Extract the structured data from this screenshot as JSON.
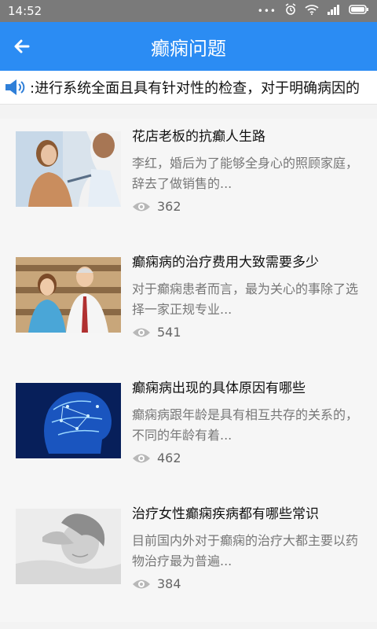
{
  "status": {
    "time": "14:52",
    "dots": "•••"
  },
  "header": {
    "title": "癫痫问题",
    "back_icon": "arrow-left-icon"
  },
  "notice": {
    "icon": "speaker-icon",
    "text": ":进行系统全面且具有针对性的检查，对于明确病因的"
  },
  "articles": [
    {
      "title": "花店老板的抗癫人生路",
      "summary": "李红，婚后为了能够全身心的照顾家庭，辞去了做销售的...",
      "views": "362"
    },
    {
      "title": "癫痫病的治疗费用大致需要多少",
      "summary": "对于癫痫患者而言，最为关心的事除了选择一家正规专业...",
      "views": "541"
    },
    {
      "title": "癫痫病出现的具体原因有哪些",
      "summary": "癫痫病跟年龄是具有相互共存的关系的，不同的年龄有着...",
      "views": "462"
    },
    {
      "title": "治疗女性癫痫疾病都有哪些常识",
      "summary": "目前国内外对于癫痫的治疗大都主要以药物治疗最为普遍...",
      "views": "384"
    }
  ],
  "colors": {
    "accent": "#2b8cf3",
    "status_bar": "#7a7a7a"
  }
}
